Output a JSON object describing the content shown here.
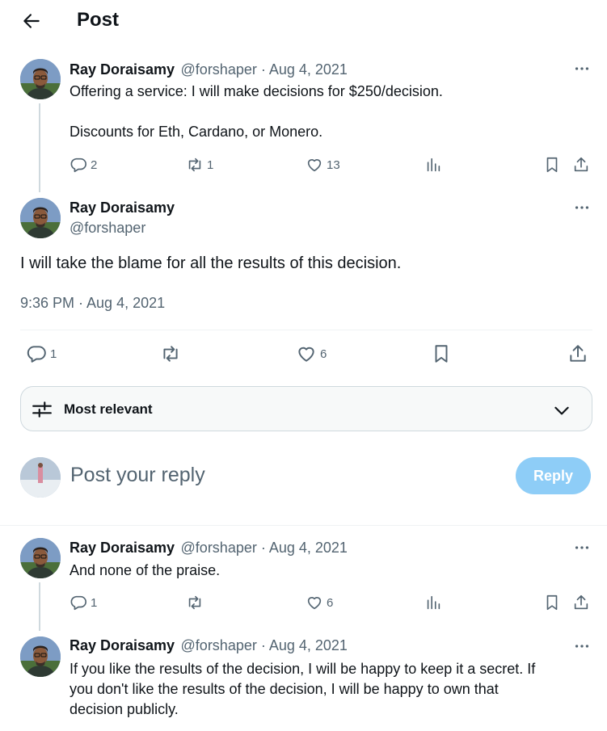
{
  "header": {
    "title": "Post"
  },
  "parent_post": {
    "name": "Ray Doraisamy",
    "meta": "@forshaper · Aug 4, 2021",
    "line1": "Offering a service: I will make decisions for $250/decision.",
    "line2": "Discounts for Eth, Cardano, or Monero.",
    "replies": "2",
    "reposts": "1",
    "likes": "13"
  },
  "main_post": {
    "name": "Ray Doraisamy",
    "handle": "@forshaper",
    "text": "I will take the blame for all the results of this decision.",
    "timestamp": "9:36 PM · Aug 4, 2021",
    "replies": "1",
    "likes": "6"
  },
  "sort": {
    "label": "Most relevant"
  },
  "composer": {
    "placeholder": "Post your reply",
    "button": "Reply"
  },
  "reply1": {
    "name": "Ray Doraisamy",
    "meta": "@forshaper · Aug 4, 2021",
    "text": "And none of the praise.",
    "replies": "1",
    "likes": "6"
  },
  "reply2": {
    "name": "Ray Doraisamy",
    "meta": "@forshaper · Aug 4, 2021",
    "line1": "If you like the results of the decision, I will be happy to keep it a secret. If",
    "line2": "you don't like the results of the decision, I will be happy to own that",
    "line3": "decision publicly."
  },
  "icons": {
    "back": "arrow-left-icon",
    "more": "more-dots-icon",
    "reply": "comment-icon",
    "repost": "repost-icon",
    "like": "heart-icon",
    "views": "views-icon",
    "bookmark": "bookmark-icon",
    "share": "share-icon",
    "sort": "sliders-icon",
    "chevron": "chevron-down-icon"
  },
  "colors": {
    "accent": "#1d9bf0",
    "reply_button_disabled": "#8ecdf7",
    "muted": "#536471"
  }
}
